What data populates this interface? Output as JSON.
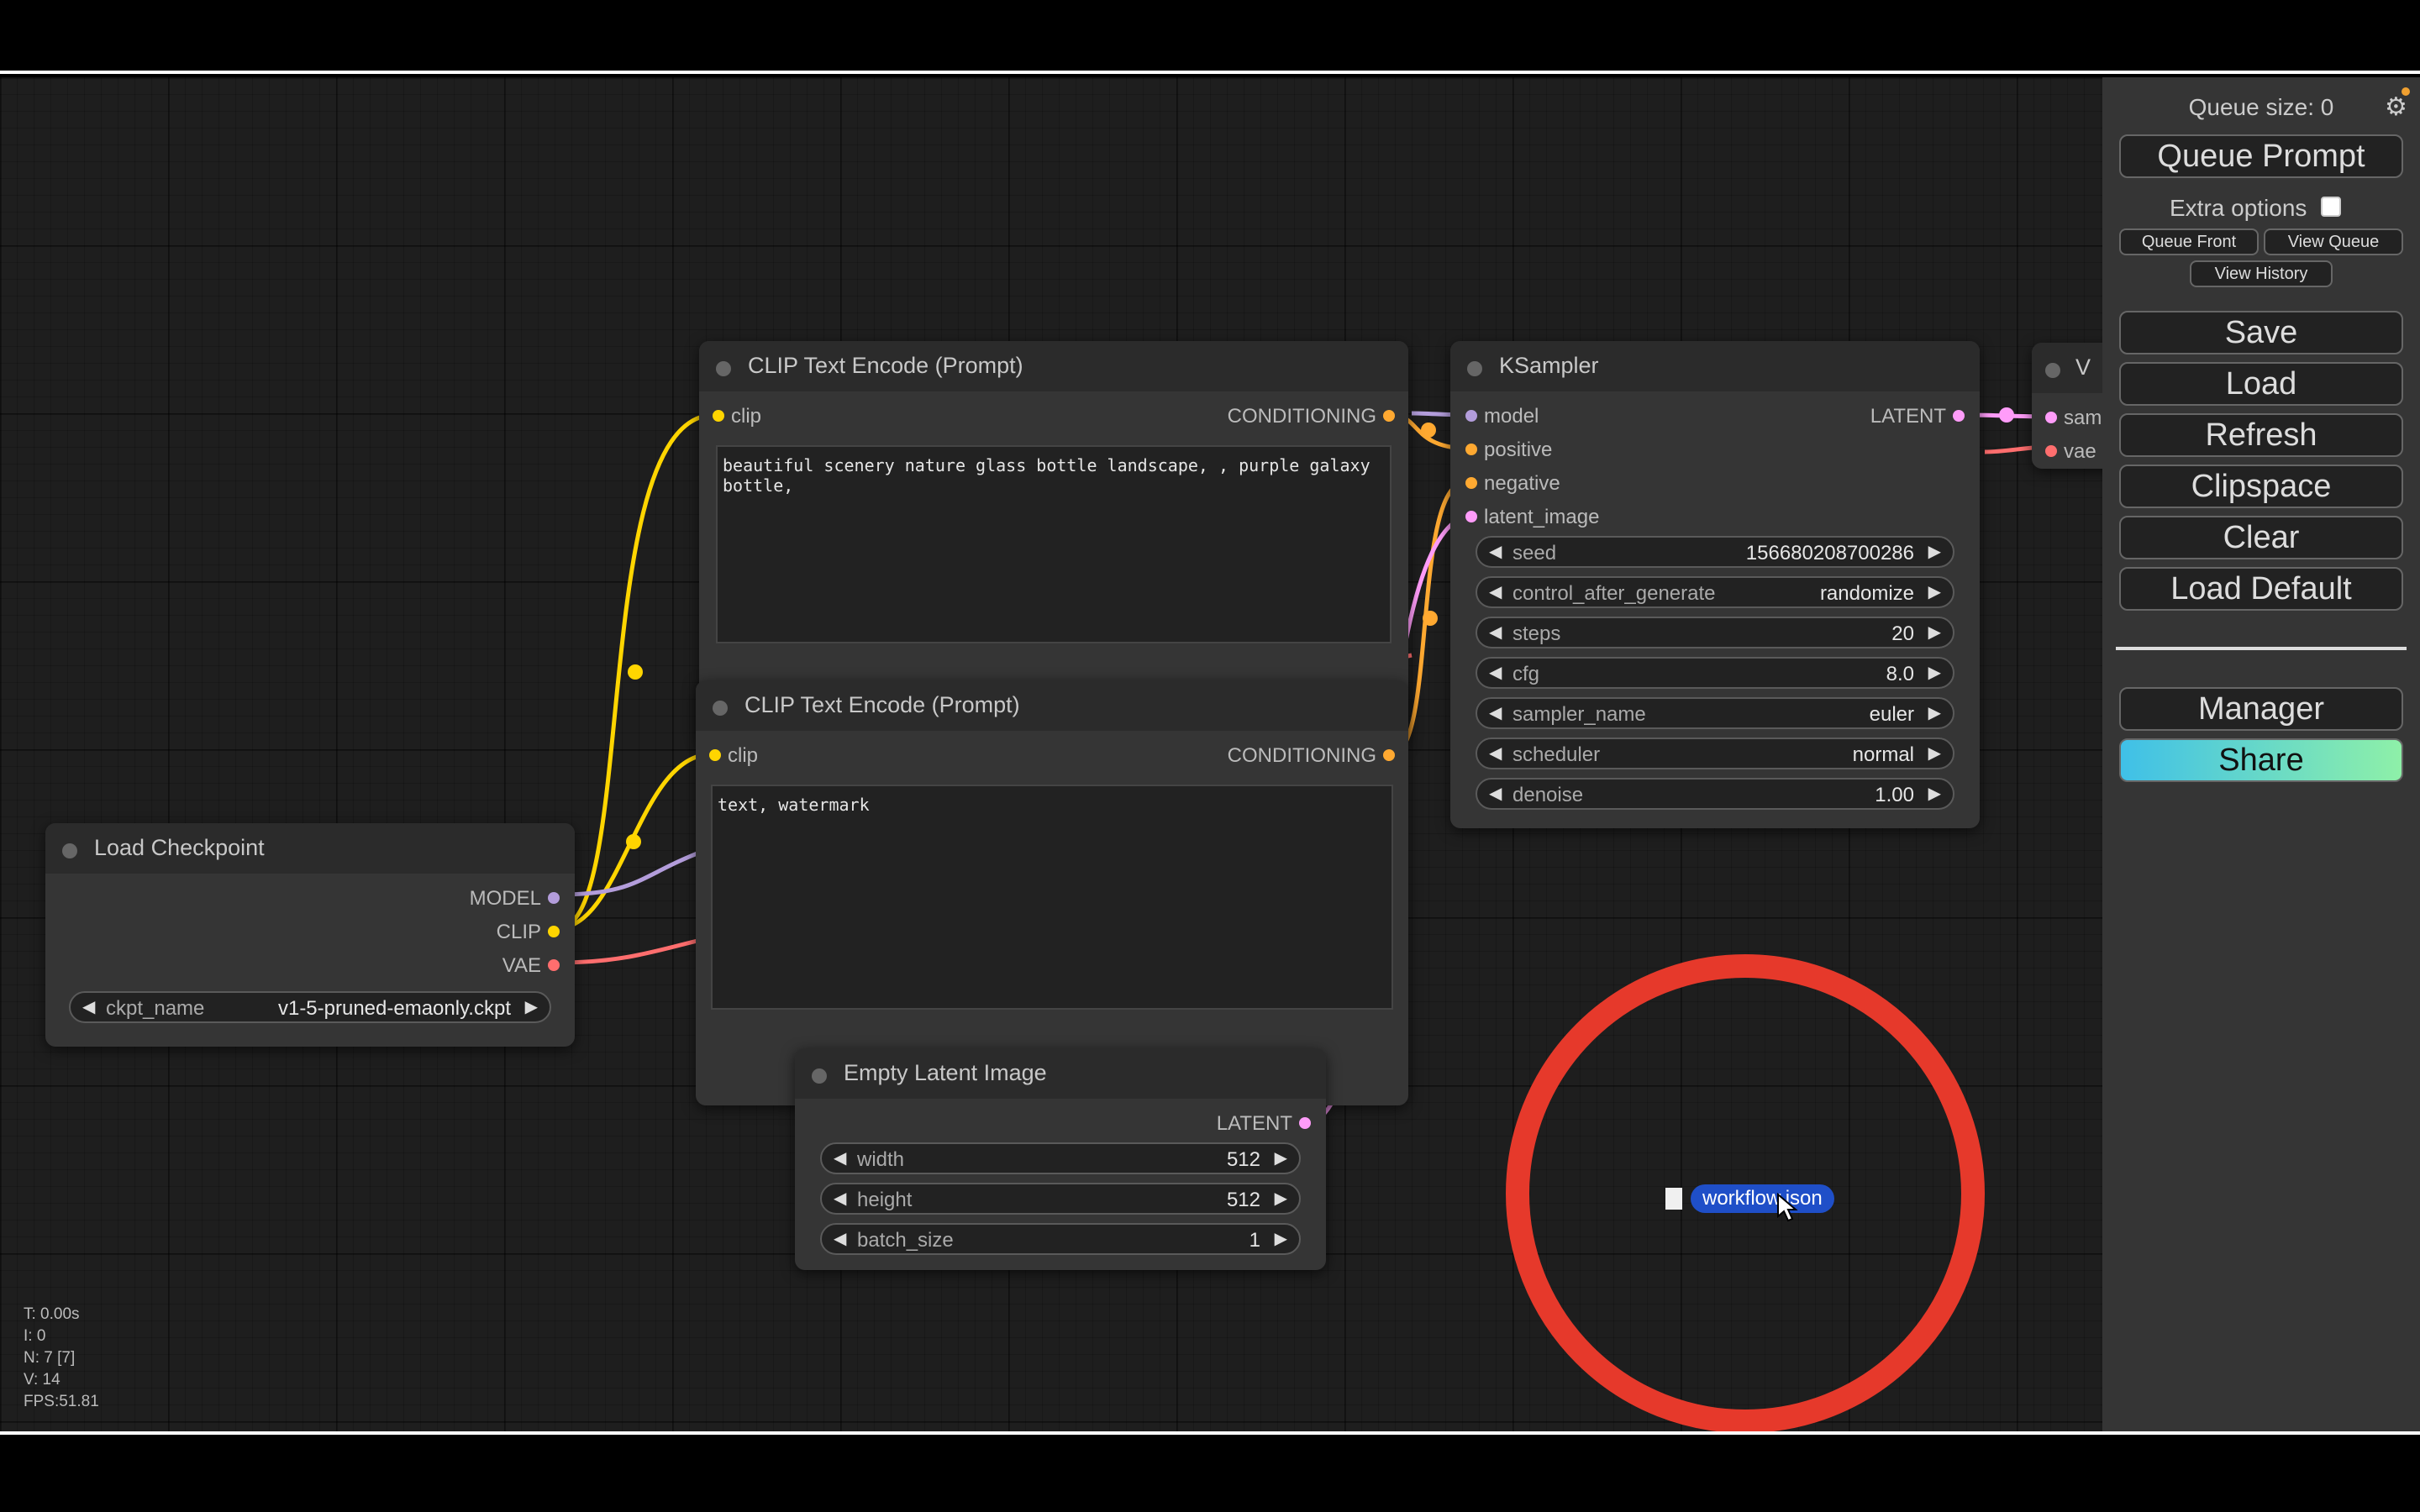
{
  "queue": {
    "size_label": "Queue size: 0",
    "queue_prompt": "Queue Prompt",
    "extra_options": "Extra options",
    "queue_front": "Queue Front",
    "view_queue": "View Queue",
    "view_history": "View History",
    "buttons": [
      "Save",
      "Load",
      "Refresh",
      "Clipspace",
      "Clear",
      "Load Default"
    ],
    "manager": "Manager",
    "share": "Share"
  },
  "stats": [
    "T: 0.00s",
    "I: 0",
    "N: 7 [7]",
    "V: 14",
    "FPS:51.81"
  ],
  "nodes": {
    "clip_pos": {
      "title": "CLIP Text Encode (Prompt)",
      "input": "clip",
      "output": "CONDITIONING",
      "text": "beautiful scenery nature glass bottle landscape, , purple galaxy\nbottle,"
    },
    "clip_neg": {
      "title": "CLIP Text Encode (Prompt)",
      "input": "clip",
      "output": "CONDITIONING",
      "text": "text, watermark"
    },
    "ksampler": {
      "title": "KSampler",
      "inputs": [
        "model",
        "positive",
        "negative",
        "latent_image"
      ],
      "output": "LATENT",
      "widgets": [
        {
          "name": "seed",
          "value": "156680208700286"
        },
        {
          "name": "control_after_generate",
          "value": "randomize"
        },
        {
          "name": "steps",
          "value": "20"
        },
        {
          "name": "cfg",
          "value": "8.0"
        },
        {
          "name": "sampler_name",
          "value": "euler"
        },
        {
          "name": "scheduler",
          "value": "normal"
        },
        {
          "name": "denoise",
          "value": "1.00"
        }
      ]
    },
    "checkpoint": {
      "title": "Load Checkpoint",
      "outputs": [
        "MODEL",
        "CLIP",
        "VAE"
      ],
      "widget": {
        "name": "ckpt_name",
        "value": "v1-5-pruned-emaonly.ckpt"
      }
    },
    "latent": {
      "title": "Empty Latent Image",
      "output": "LATENT",
      "widgets": [
        {
          "name": "width",
          "value": "512"
        },
        {
          "name": "height",
          "value": "512"
        },
        {
          "name": "batch_size",
          "value": "1"
        }
      ]
    },
    "vae_decode": {
      "title": "V",
      "inputs": [
        "sam",
        "vae"
      ]
    }
  },
  "drag": {
    "filename": "workflow.json"
  },
  "colors": {
    "clip": "#ffd500",
    "conditioning": "#ffa931",
    "model": "#b39ddb",
    "latent": "#ff9cf9",
    "vae": "#ff6e6e",
    "highlight_circle": "#e6392b"
  }
}
